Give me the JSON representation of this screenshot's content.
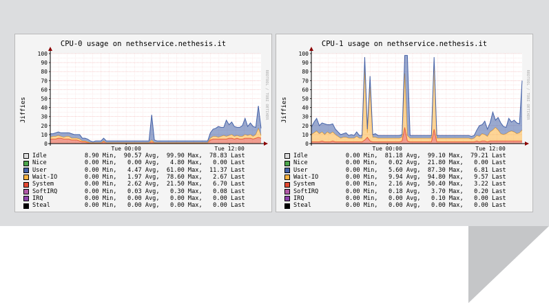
{
  "chart_data": [
    {
      "type": "area",
      "title": "CPU-0 usage on nethservice.nethesis.it",
      "ylabel": "Jiffies",
      "ylim": [
        0,
        100
      ],
      "yticks": [
        0,
        10,
        20,
        30,
        40,
        50,
        60,
        70,
        80,
        90,
        100
      ],
      "xticks": [
        "Tue 00:00",
        "Tue 12:00"
      ],
      "watermark": "RRDTOOL / TOBI OETIKER",
      "grid": true,
      "stacked": true,
      "series_profiles": [
        {
          "name": "System",
          "color": "#e34a33",
          "values": [
            5,
            5,
            5,
            6,
            6,
            5,
            5,
            5,
            4,
            4,
            4,
            3,
            2,
            2,
            1,
            1,
            1,
            1,
            1,
            1,
            2,
            1,
            1,
            1,
            1,
            1,
            1,
            1,
            1,
            1,
            1,
            1,
            1,
            1,
            1,
            1,
            1,
            1,
            2,
            1,
            1,
            1,
            1,
            1,
            1,
            1,
            1,
            1,
            1,
            1,
            1,
            1,
            1,
            1,
            1,
            1,
            1,
            1,
            1,
            1,
            4,
            5,
            5,
            5,
            5,
            5,
            5,
            6,
            6,
            5,
            6,
            5,
            5,
            6,
            6,
            6,
            5,
            6,
            7,
            6
          ]
        },
        {
          "name": "Wait-IO",
          "color": "#fcb340",
          "values": [
            2,
            3,
            3,
            3,
            2,
            2,
            3,
            3,
            2,
            2,
            2,
            2,
            1,
            1,
            1,
            0,
            0,
            0,
            0,
            0,
            1,
            0,
            0,
            0,
            0,
            0,
            0,
            0,
            0,
            0,
            0,
            0,
            0,
            0,
            0,
            0,
            0,
            0,
            2,
            0,
            0,
            0,
            0,
            0,
            0,
            0,
            0,
            0,
            0,
            0,
            0,
            0,
            0,
            0,
            0,
            0,
            0,
            0,
            0,
            0,
            2,
            3,
            3,
            2,
            3,
            4,
            3,
            3,
            4,
            3,
            3,
            3,
            3,
            4,
            3,
            4,
            3,
            4,
            10,
            3
          ]
        },
        {
          "name": "User",
          "color": "#4562a8",
          "values": [
            4,
            3,
            4,
            4,
            4,
            5,
            4,
            4,
            5,
            4,
            4,
            5,
            3,
            3,
            3,
            2,
            1,
            2,
            2,
            2,
            3,
            2,
            2,
            2,
            2,
            2,
            2,
            2,
            2,
            2,
            2,
            2,
            2,
            2,
            2,
            2,
            2,
            2,
            28,
            3,
            2,
            2,
            2,
            2,
            2,
            2,
            2,
            2,
            2,
            2,
            2,
            2,
            2,
            2,
            2,
            2,
            2,
            2,
            2,
            2,
            6,
            8,
            9,
            12,
            10,
            9,
            18,
            12,
            14,
            11,
            9,
            10,
            12,
            18,
            10,
            13,
            11,
            8,
            25,
            8
          ]
        }
      ],
      "legend": [
        {
          "name": "Idle",
          "color": "#dedede",
          "min": "8.90",
          "avg": "90.57",
          "max": "99.90",
          "last": "78.83"
        },
        {
          "name": "Nice",
          "color": "#4ca64c",
          "min": "0.00",
          "avg": "0.00",
          "max": "4.80",
          "last": "0.00"
        },
        {
          "name": "User",
          "color": "#4562a8",
          "min": "0.00",
          "avg": "4.47",
          "max": "61.00",
          "last": "11.37"
        },
        {
          "name": "Wait-IO",
          "color": "#fcb340",
          "min": "0.00",
          "avg": "1.97",
          "max": "78.60",
          "last": "2.67"
        },
        {
          "name": "System",
          "color": "#e34a33",
          "min": "0.00",
          "avg": "2.62",
          "max": "21.50",
          "last": "6.70"
        },
        {
          "name": "SoftIRQ",
          "color": "#b05aa8",
          "min": "0.00",
          "avg": "0.03",
          "max": "0.30",
          "last": "0.08"
        },
        {
          "name": "IRQ",
          "color": "#8e44ad",
          "min": "0.00",
          "avg": "0.00",
          "max": "0.00",
          "last": "0.00"
        },
        {
          "name": "Steal",
          "color": "#000000",
          "min": "0.00",
          "avg": "0.00",
          "max": "0.00",
          "last": "0.00"
        }
      ]
    },
    {
      "type": "area",
      "title": "CPU-1 usage on nethservice.nethesis.it",
      "ylabel": "Jiffies",
      "ylim": [
        0,
        100
      ],
      "yticks": [
        0,
        10,
        20,
        30,
        40,
        50,
        60,
        70,
        80,
        90,
        100
      ],
      "xticks": [
        "Tue 00:00",
        "Tue 12:00"
      ],
      "watermark": "RRDTOOL / TOBI OETIKER",
      "grid": true,
      "stacked": true,
      "series_profiles": [
        {
          "name": "System",
          "color": "#e34a33",
          "values": [
            2,
            2,
            2,
            2,
            3,
            2,
            2,
            2,
            3,
            2,
            2,
            2,
            2,
            2,
            2,
            2,
            2,
            2,
            2,
            2,
            4,
            7,
            3,
            2,
            2,
            2,
            2,
            2,
            2,
            2,
            2,
            2,
            2,
            2,
            3,
            18,
            3,
            2,
            2,
            2,
            2,
            2,
            2,
            2,
            2,
            2,
            16,
            2,
            2,
            2,
            2,
            2,
            2,
            2,
            2,
            2,
            2,
            2,
            2,
            2,
            2,
            2,
            3,
            2,
            3,
            3,
            2,
            3,
            3,
            3,
            3,
            3,
            3,
            3,
            3,
            3,
            3,
            3,
            3,
            3
          ]
        },
        {
          "name": "Wait-IO",
          "color": "#fcb340",
          "values": [
            8,
            10,
            12,
            9,
            10,
            8,
            11,
            9,
            10,
            8,
            6,
            4,
            5,
            5,
            4,
            4,
            4,
            6,
            4,
            4,
            80,
            5,
            60,
            5,
            5,
            4,
            4,
            4,
            4,
            4,
            4,
            4,
            4,
            4,
            4,
            60,
            6,
            4,
            4,
            4,
            4,
            4,
            4,
            4,
            4,
            4,
            75,
            4,
            4,
            4,
            4,
            4,
            4,
            4,
            4,
            4,
            4,
            4,
            4,
            4,
            3,
            4,
            6,
            6,
            8,
            7,
            6,
            10,
            12,
            15,
            12,
            8,
            7,
            8,
            10,
            11,
            10,
            8,
            9,
            12
          ]
        },
        {
          "name": "User",
          "color": "#4562a8",
          "values": [
            8,
            12,
            14,
            9,
            10,
            12,
            8,
            10,
            9,
            6,
            5,
            4,
            4,
            5,
            3,
            4,
            3,
            5,
            3,
            3,
            12,
            4,
            12,
            3,
            4,
            3,
            3,
            3,
            3,
            3,
            3,
            3,
            3,
            3,
            3,
            20,
            89,
            3,
            3,
            3,
            3,
            3,
            3,
            3,
            3,
            3,
            5,
            3,
            3,
            3,
            3,
            3,
            3,
            3,
            3,
            3,
            3,
            3,
            3,
            3,
            3,
            3,
            6,
            12,
            10,
            15,
            8,
            10,
            20,
            8,
            14,
            12,
            9,
            7,
            15,
            10,
            13,
            12,
            10,
            55
          ]
        }
      ],
      "legend": [
        {
          "name": "Idle",
          "color": "#dedede",
          "min": "0.00",
          "avg": "81.18",
          "max": "99.10",
          "last": "79.21"
        },
        {
          "name": "Nice",
          "color": "#4ca64c",
          "min": "0.00",
          "avg": "0.02",
          "max": "21.80",
          "last": "0.00"
        },
        {
          "name": "User",
          "color": "#4562a8",
          "min": "0.00",
          "avg": "5.60",
          "max": "87.30",
          "last": "6.81"
        },
        {
          "name": "Wait-IO",
          "color": "#fcb340",
          "min": "0.00",
          "avg": "9.94",
          "max": "94.80",
          "last": "9.57"
        },
        {
          "name": "System",
          "color": "#e34a33",
          "min": "0.00",
          "avg": "2.16",
          "max": "50.40",
          "last": "3.22"
        },
        {
          "name": "SoftIRQ",
          "color": "#b05aa8",
          "min": "0.00",
          "avg": "0.18",
          "max": "3.70",
          "last": "0.20"
        },
        {
          "name": "IRQ",
          "color": "#8e44ad",
          "min": "0.00",
          "avg": "0.00",
          "max": "0.10",
          "last": "0.00"
        },
        {
          "name": "Steal",
          "color": "#000000",
          "min": "0.00",
          "avg": "0.00",
          "max": "0.00",
          "last": "0.00"
        }
      ]
    }
  ],
  "legend_terms": {
    "min": "Min,",
    "avg": "Avg,",
    "max": "Max,",
    "last": "Last"
  },
  "colors": {
    "band": "#dcdddf",
    "fold": "#c5c6c8",
    "grid_major": "#f0a8a8",
    "grid_minor": "#f7dada",
    "axis_arrow": "#8b0000"
  }
}
